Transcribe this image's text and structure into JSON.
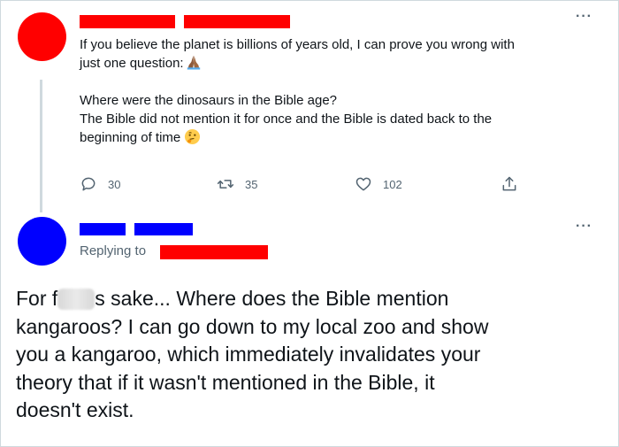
{
  "tweet1": {
    "lines": [
      "If you believe the planet is billions of years old, I can prove you wrong with",
      "just one question:",
      "Where were the dinosaurs in the Bible age?",
      "The Bible did not mention it for once and the Bible is dated back to the",
      "beginning of time"
    ],
    "emoji_after_line_2": "folded-hands-emoji",
    "emoji_after_line_5": "thinking-face-emoji",
    "actions": {
      "replies": "30",
      "retweets": "35",
      "likes": "102"
    },
    "avatar_color": "#ff0000",
    "redaction_color": "#ff0000"
  },
  "tweet2": {
    "replying_to_label": "Replying to",
    "lines_before_censor": "For f",
    "lines": [
      "s sake... Where does the Bible mention",
      "kangaroos? I can go down to my local zoo and show",
      "you a kangaroo, which immediately invalidates your",
      "theory that if it wasn't mentioned in the Bible, it",
      "doesn't exist."
    ],
    "avatar_color": "#0000ff",
    "redaction_color": "#0000ff",
    "reply_target_redaction_color": "#ff0000"
  },
  "icons": {
    "more": "more-icon",
    "reply": "reply-icon",
    "retweet": "retweet-icon",
    "like": "like-icon",
    "share": "share-icon"
  }
}
